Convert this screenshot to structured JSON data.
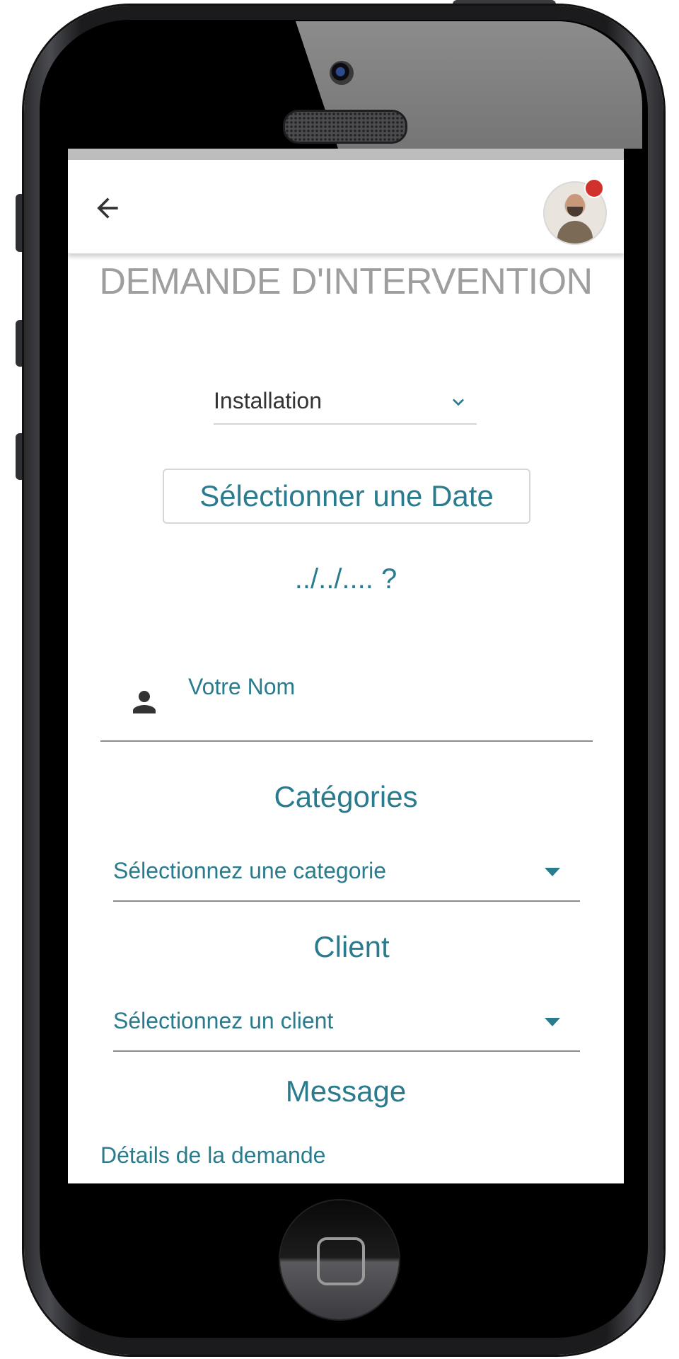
{
  "header": {
    "back_icon": "arrow-left-icon",
    "avatar_icon": "user-avatar",
    "notification_color": "#d0312d"
  },
  "page": {
    "title": "DEMANDE D'INTERVENTION"
  },
  "form": {
    "type_select": {
      "value": "Installation",
      "icon": "chevron-down-icon"
    },
    "date_button_label": "Sélectionner une Date",
    "date_value": "../../.... ?",
    "name_field": {
      "label": "Votre Nom",
      "icon": "person-icon"
    },
    "categories": {
      "heading": "Catégories",
      "placeholder": "Sélectionnez une categorie"
    },
    "client": {
      "heading": "Client",
      "placeholder": "Sélectionnez un client"
    },
    "message": {
      "heading": "Message",
      "label": "Détails de la demande"
    }
  },
  "theme": {
    "accent": "#2a7b8d",
    "title_gray": "#9e9e9e"
  }
}
